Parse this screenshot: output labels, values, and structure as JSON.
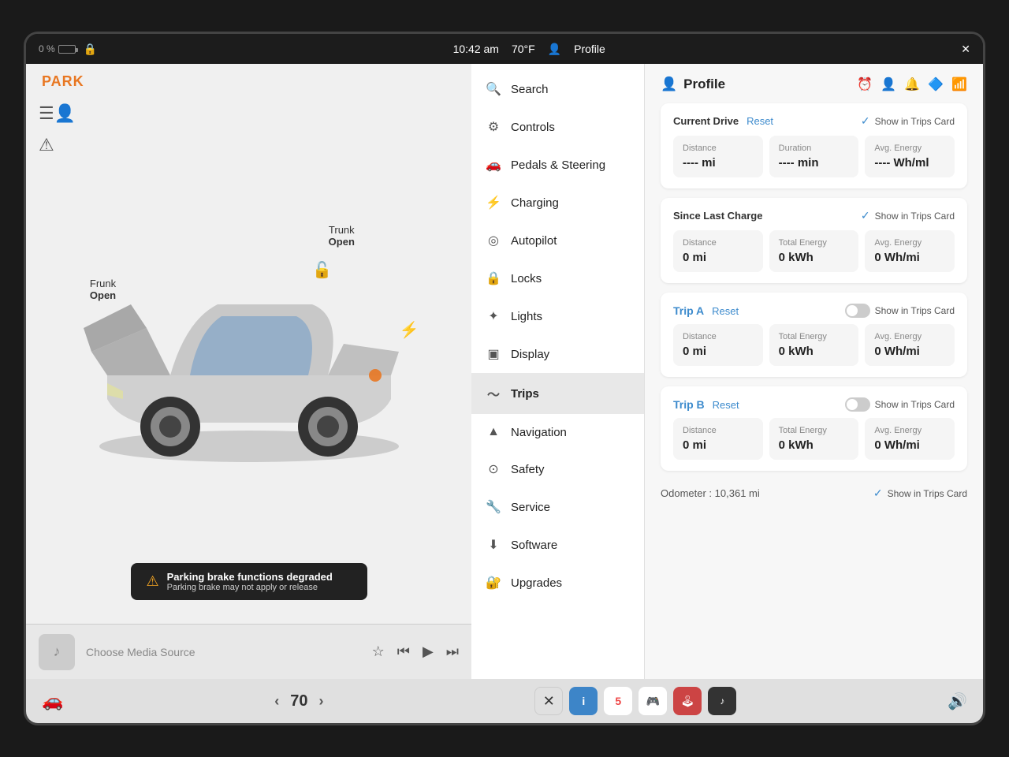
{
  "topbar": {
    "battery_pct": "0 %",
    "time": "10:42 am",
    "temperature": "70°F",
    "profile_label": "Profile"
  },
  "left_panel": {
    "park_label": "PARK",
    "frunk_label": "Frunk",
    "frunk_status": "Open",
    "trunk_label": "Trunk",
    "trunk_status": "Open",
    "warning_title": "Parking brake functions degraded",
    "warning_sub": "Parking brake may not apply or release"
  },
  "media": {
    "label": "Choose Media Source"
  },
  "bottom_bar": {
    "temperature": "70",
    "apps": [
      "✕",
      "ℹ",
      "5",
      "🎮",
      "🕹",
      "♪"
    ]
  },
  "menu": {
    "items": [
      {
        "id": "search",
        "label": "Search",
        "icon": "🔍"
      },
      {
        "id": "controls",
        "label": "Controls",
        "icon": "⚙"
      },
      {
        "id": "pedals",
        "label": "Pedals & Steering",
        "icon": "🚗"
      },
      {
        "id": "charging",
        "label": "Charging",
        "icon": "⚡"
      },
      {
        "id": "autopilot",
        "label": "Autopilot",
        "icon": "🎯"
      },
      {
        "id": "locks",
        "label": "Locks",
        "icon": "🔒"
      },
      {
        "id": "lights",
        "label": "Lights",
        "icon": "💡"
      },
      {
        "id": "display",
        "label": "Display",
        "icon": "🖥"
      },
      {
        "id": "trips",
        "label": "Trips",
        "icon": "〜",
        "active": true
      },
      {
        "id": "navigation",
        "label": "Navigation",
        "icon": "▲"
      },
      {
        "id": "safety",
        "label": "Safety",
        "icon": "⊙"
      },
      {
        "id": "service",
        "label": "Service",
        "icon": "🔧"
      },
      {
        "id": "software",
        "label": "Software",
        "icon": "⬇"
      },
      {
        "id": "upgrades",
        "label": "Upgrades",
        "icon": "🔐"
      }
    ]
  },
  "profile": {
    "title": "Profile",
    "current_drive": {
      "label": "Current Drive",
      "reset": "Reset",
      "show_trips": "Show in Trips Card",
      "show_trips_checked": true,
      "distance_label": "Distance",
      "distance_value": "---- mi",
      "duration_label": "Duration",
      "duration_value": "---- min",
      "avg_energy_label": "Avg. Energy",
      "avg_energy_value": "---- Wh/ml"
    },
    "since_last_charge": {
      "label": "Since Last Charge",
      "show_trips": "Show in Trips Card",
      "show_trips_checked": true,
      "distance_label": "Distance",
      "distance_value": "0 mi",
      "total_energy_label": "Total Energy",
      "total_energy_value": "0 kWh",
      "avg_energy_label": "Avg. Energy",
      "avg_energy_value": "0 Wh/mi"
    },
    "trip_a": {
      "label": "Trip A",
      "reset": "Reset",
      "show_trips": "Show in Trips Card",
      "show_trips_checked": false,
      "distance_label": "Distance",
      "distance_value": "0 mi",
      "total_energy_label": "Total Energy",
      "total_energy_value": "0 kWh",
      "avg_energy_label": "Avg. Energy",
      "avg_energy_value": "0 Wh/mi"
    },
    "trip_b": {
      "label": "Trip B",
      "reset": "Reset",
      "show_trips": "Show in Trips Card",
      "show_trips_checked": false,
      "distance_label": "Distance",
      "distance_value": "0 mi",
      "total_energy_label": "Total Energy",
      "total_energy_value": "0 kWh",
      "avg_energy_label": "Avg. Energy",
      "avg_energy_value": "0 Wh/mi"
    },
    "odometer_label": "Odometer :",
    "odometer_value": "10,361 mi",
    "odometer_show_trips": "Show in Trips Card",
    "odometer_checked": true
  }
}
